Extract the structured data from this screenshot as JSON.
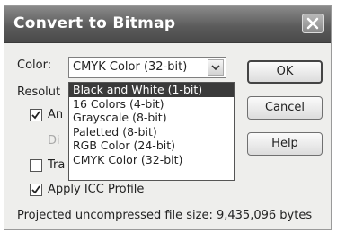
{
  "dialog": {
    "title": "Convert to Bitmap"
  },
  "color": {
    "label": "Color:",
    "selected": "CMYK Color (32-bit)",
    "options": [
      "Black and White (1-bit)",
      "16 Colors (4-bit)",
      "Grayscale (8-bit)",
      "Paletted (8-bit)",
      "RGB Color (24-bit)",
      "CMYK Color (32-bit)"
    ],
    "highlighted_option": "Black and White (1-bit)"
  },
  "resolution": {
    "label": "Resolut"
  },
  "checkboxes": {
    "anti": {
      "label": "An",
      "checked": true
    },
    "dither": {
      "label": "Di",
      "disabled": true
    },
    "transparent": {
      "label": "Tra",
      "checked": false
    },
    "icc": {
      "label": "Apply ICC Profile",
      "checked": true
    }
  },
  "buttons": {
    "ok": "OK",
    "cancel": "Cancel",
    "help": "Help"
  },
  "footer": {
    "projected": "Projected uncompressed file size: 9,435,096 bytes"
  },
  "colors": {
    "title_bar": "#5c5c5c",
    "selection": "#3a3a3a"
  }
}
